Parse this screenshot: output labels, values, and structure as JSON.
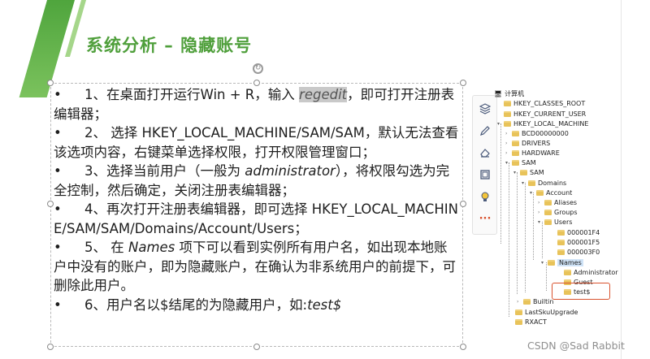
{
  "slide": {
    "title": "系统分析 – 隐藏账号"
  },
  "steps": [
    {
      "bullet": "•",
      "pre": "1、在桌面打开运行Win + R，输入 ",
      "code": "regedit",
      "post": "，即可打开注册表编辑器；"
    },
    {
      "bullet": "•",
      "text": "2、 选择 HKEY_LOCAL_MACHINE/SAM/SAM，默认无法查看该选项内容，右键菜单选择权限，打开权限管理窗口；"
    },
    {
      "bullet": "•",
      "pre": "3、选择当前用户（一般为 ",
      "em": "administrator",
      "post": "），将权限勾选为完全控制，然后确定，关闭注册表编辑器；"
    },
    {
      "bullet": "•",
      "text": "4、再次打开注册表编辑器，即可选择 HKEY_LOCAL_MACHINE/SAM/SAM/Domains/Account/Users；"
    },
    {
      "bullet": "•",
      "pre": "5、 在 ",
      "em": "Names",
      "post": " 项下可以看到实例所有用户名，如出现本地账户中没有的账户，即为隐藏账户，在确认为非系统用户的前提下，可删除此用户。"
    },
    {
      "bullet": "•",
      "pre": "6、用户名以$结尾的为隐藏用户，如:",
      "em": "test$",
      "post": ""
    }
  ],
  "toolbar": {
    "icons": [
      "layers-icon",
      "pen-icon",
      "eraser-icon",
      "crop-icon",
      "bulb-icon",
      "more-icon"
    ],
    "more_glyph": "···"
  },
  "registry": {
    "nodes": [
      {
        "label": "计算机",
        "type": "computer"
      },
      {
        "label": "HKEY_CLASSES_ROOT"
      },
      {
        "label": "HKEY_CURRENT_USER"
      },
      {
        "label": "HKEY_LOCAL_MACHINE"
      },
      {
        "label": "BCD00000000"
      },
      {
        "label": "DRIVERS"
      },
      {
        "label": "HARDWARE"
      },
      {
        "label": "SAM"
      },
      {
        "label": "SAM"
      },
      {
        "label": "Domains"
      },
      {
        "label": "Account"
      },
      {
        "label": "Aliases"
      },
      {
        "label": "Groups"
      },
      {
        "label": "Users"
      },
      {
        "label": "000001F4"
      },
      {
        "label": "000001F5"
      },
      {
        "label": "000003F0"
      },
      {
        "label": "Names"
      },
      {
        "label": "Administrator"
      },
      {
        "label": "Guest"
      },
      {
        "label": "test$"
      },
      {
        "label": "Builtin"
      },
      {
        "label": "LastSkuUpgrade"
      },
      {
        "label": "RXACT"
      }
    ]
  },
  "watermark": "CSDN @Sad Rabbit",
  "colors": {
    "title_green": "#4f9f3b",
    "band_green": "#4fa53d",
    "highlight_box": "#d9532f",
    "folder": "#e8c35a"
  }
}
